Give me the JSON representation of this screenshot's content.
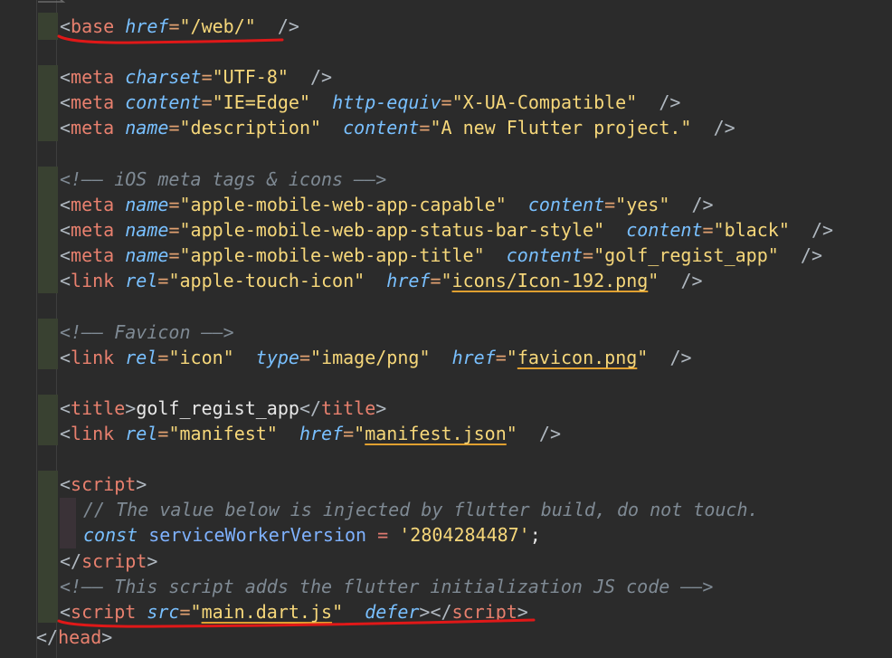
{
  "code": {
    "base": {
      "tag": "base",
      "attr": "href",
      "val": "/web/"
    },
    "meta_charset": {
      "tag": "meta",
      "attr": "charset",
      "val": "UTF-8"
    },
    "meta_compat": {
      "tag": "meta",
      "attr1": "content",
      "val1": "IE=Edge",
      "attr2": "http-equiv",
      "val2": "X-UA-Compatible"
    },
    "meta_desc": {
      "tag": "meta",
      "attr1": "name",
      "val1": "description",
      "attr2": "content",
      "val2": "A new Flutter project."
    },
    "comment_ios": "<!—— iOS meta tags & icons ——>",
    "meta_capable": {
      "tag": "meta",
      "attr1": "name",
      "val1": "apple-mobile-web-app-capable",
      "attr2": "content",
      "val2": "yes"
    },
    "meta_status": {
      "tag": "meta",
      "attr1": "name",
      "val1": "apple-mobile-web-app-status-bar-style",
      "attr2": "content",
      "val2": "black"
    },
    "meta_title": {
      "tag": "meta",
      "attr1": "name",
      "val1": "apple-mobile-web-app-title",
      "attr2": "content",
      "val2": "golf_regist_app"
    },
    "link_touch": {
      "tag": "link",
      "attr1": "rel",
      "val1": "apple-touch-icon",
      "attr2": "href",
      "val2": "icons/Icon-192.png"
    },
    "comment_favicon": "<!—— Favicon ——>",
    "link_icon": {
      "tag": "link",
      "attr1": "rel",
      "val1": "icon",
      "attr2": "type",
      "val2": "image/png",
      "attr3": "href",
      "val3": "favicon.png"
    },
    "title": {
      "tag": "title",
      "text": "golf_regist_app"
    },
    "link_manifest": {
      "tag": "link",
      "attr1": "rel",
      "val1": "manifest",
      "attr2": "href",
      "val2": "manifest.json"
    },
    "script_open": "script",
    "js_comment": "// The value below is injected by flutter build, do not touch.",
    "js_const": {
      "kw": "const",
      "name": "serviceWorkerVersion",
      "op": "=",
      "val": "'2804284487'",
      "end": ";"
    },
    "script_close": "script",
    "comment_init": "<!—— This script adds the flutter initialization JS code ——>",
    "script_main": {
      "tag": "script",
      "attr1": "src",
      "val1": "main.dart.js",
      "attr2": "defer"
    },
    "head_close": "head"
  },
  "annotation_color": "#e01818"
}
